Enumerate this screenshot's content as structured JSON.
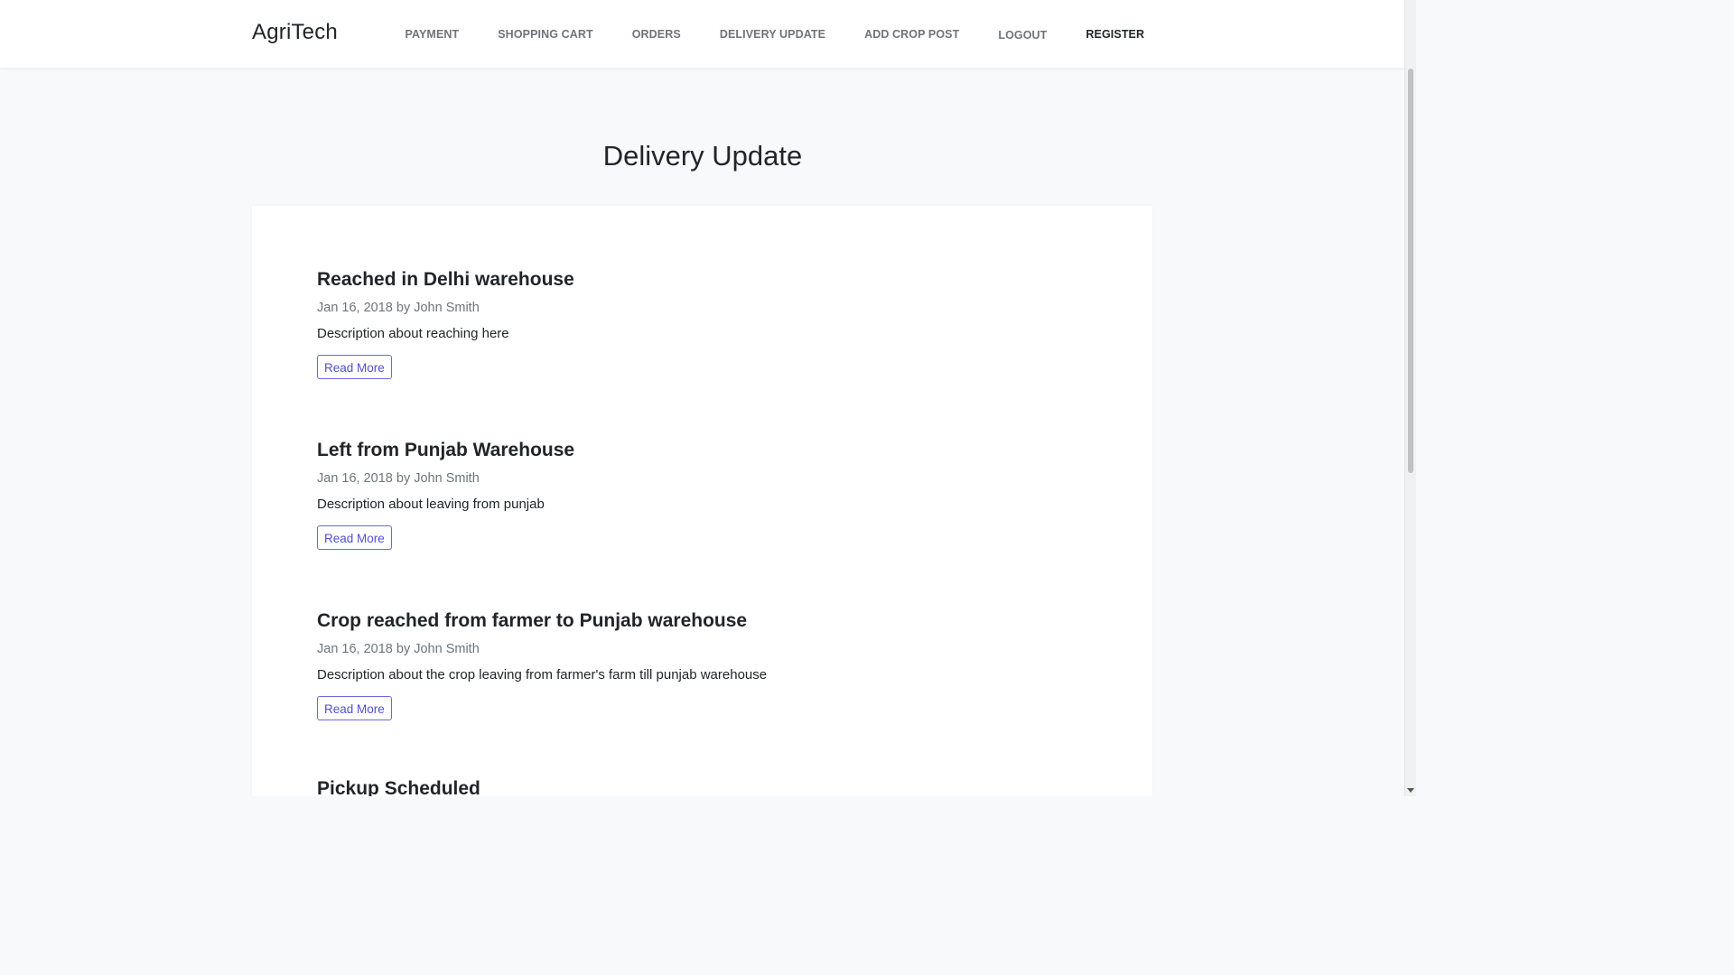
{
  "brand": "AgriTech",
  "nav": {
    "items": [
      "PAYMENT",
      "SHOPPING CART",
      "ORDERS",
      "DELIVERY UPDATE",
      "ADD CROP POST",
      "LOGOUT",
      "REGISTER"
    ]
  },
  "main": {
    "title": "Delivery Update",
    "posts": [
      {
        "title": "Reached in Delhi warehouse",
        "meta": "Jan 16, 2018 by John Smith",
        "description": "Description about reaching here",
        "button": "Read More"
      },
      {
        "title": "Left from Punjab Warehouse",
        "meta": "Jan 16, 2018 by John Smith",
        "description": "Description about leaving from punjab",
        "button": "Read More"
      },
      {
        "title": "Crop reached from farmer to Punjab warehouse",
        "meta": "Jan 16, 2018 by John Smith",
        "description": "Description about the crop leaving from farmer's farm till punjab warehouse",
        "button": "Read More"
      },
      {
        "title": "Pickup Scheduled"
      }
    ]
  }
}
